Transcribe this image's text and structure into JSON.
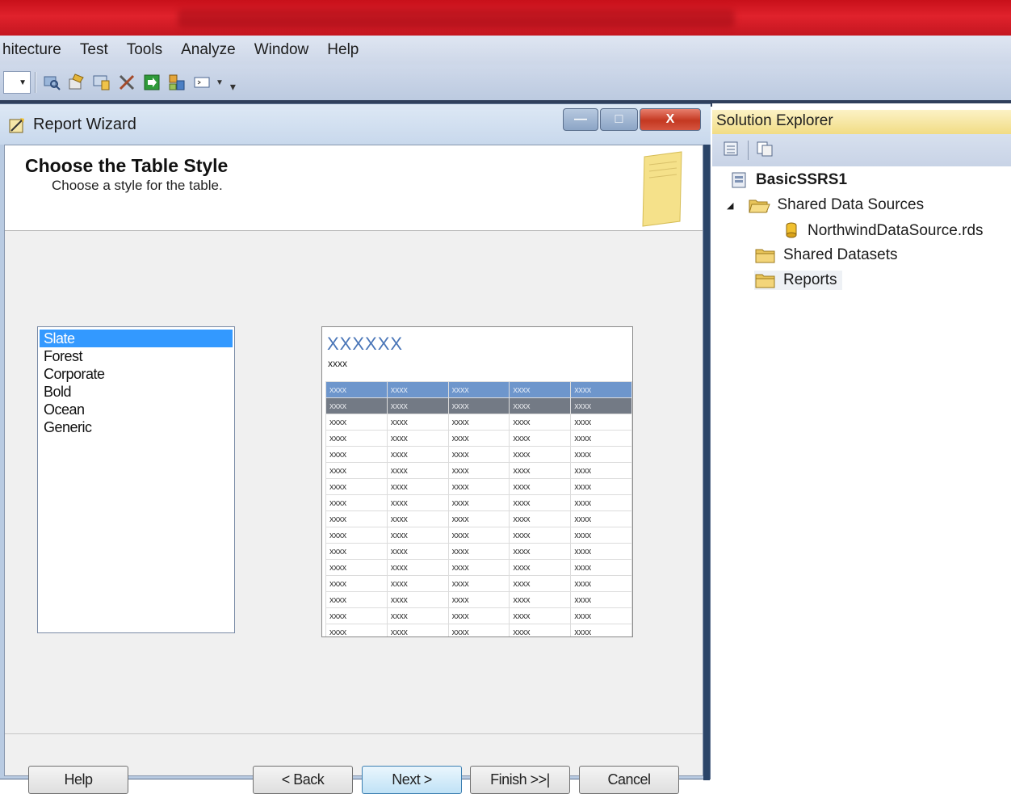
{
  "menu": {
    "items": [
      "hitecture",
      "Test",
      "Tools",
      "Analyze",
      "Window",
      "Help"
    ]
  },
  "toolbar": {
    "icons": [
      "find-icon",
      "properties-icon",
      "server-icon",
      "tools-icon",
      "import-icon",
      "layout-icon",
      "window-icon",
      "overflow-icon"
    ]
  },
  "wizard": {
    "window_title": "Report Wizard",
    "window_buttons": {
      "minimize": "—",
      "maximize": "□",
      "close": "X"
    },
    "heading": "Choose the Table Style",
    "subheading": "Choose a style for the table.",
    "styles": [
      "Slate",
      "Forest",
      "Corporate",
      "Bold",
      "Ocean",
      "Generic"
    ],
    "selected_style": "Slate",
    "preview": {
      "title": "XXXXXX",
      "subtitle": "xxxx",
      "cell_text": "xxxx",
      "columns": 5,
      "header_rows": 2,
      "data_rows": 14,
      "header_color": "#6e96cc",
      "subheader_color": "#737a85"
    },
    "buttons": {
      "help": "Help",
      "back": "< Back",
      "next": "Next >",
      "finish": "Finish >>|",
      "cancel": "Cancel"
    }
  },
  "solution_explorer": {
    "title": "Solution Explorer",
    "project": "BasicSSRS1",
    "nodes": {
      "shared_data_sources": "Shared Data Sources",
      "data_source_file": "NorthwindDataSource.rds",
      "shared_datasets": "Shared Datasets",
      "reports": "Reports"
    }
  }
}
